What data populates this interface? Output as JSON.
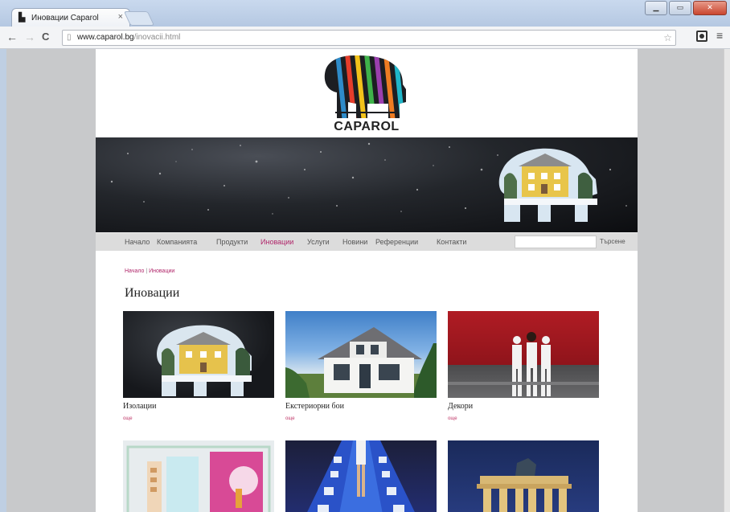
{
  "browser": {
    "tab_title": "Иновации Caparol",
    "tab_close": "×",
    "tab_icon": "elephant-favicon",
    "url_host": "www.caparol.bg",
    "url_path": "/inovacii.html",
    "nav_back": "←",
    "nav_forward": "→",
    "nav_reload": "C",
    "page_glyph": "▯",
    "star_glyph": "☆",
    "menu_glyph": "≡",
    "win_minimize": "▁",
    "win_maximize": "▭",
    "win_close": "✕"
  },
  "site": {
    "logo_text": "CAPAROL",
    "nav_items": [
      {
        "label": "Начало"
      },
      {
        "label": "Компанията"
      },
      {
        "label": "Продукти"
      },
      {
        "label": "Иновации"
      },
      {
        "label": "Услуги"
      },
      {
        "label": "Новини"
      },
      {
        "label": "Референции"
      },
      {
        "label": "Контакти"
      }
    ],
    "active_nav": "Иновации",
    "search_button": "Търсене",
    "breadcrumb": {
      "home": "Начало",
      "separator": "|",
      "current": "Иновации"
    },
    "page_title": "Иновации",
    "cards": [
      {
        "caption": "Изолации",
        "more": "още"
      },
      {
        "caption": "Екстериорни бои",
        "more": "още"
      },
      {
        "caption": "Декори",
        "more": "още"
      },
      {
        "caption": "",
        "more": ""
      },
      {
        "caption": "",
        "more": ""
      },
      {
        "caption": "",
        "more": ""
      }
    ],
    "colors": {
      "accent": "#b0266a",
      "nav_bg": "#dcdcdc",
      "banner": "#1b1d22"
    }
  }
}
